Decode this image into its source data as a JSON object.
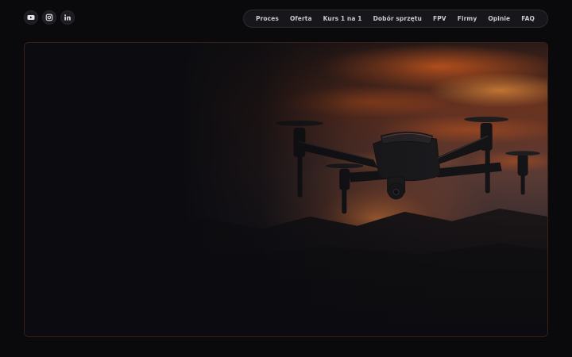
{
  "socials": [
    {
      "name": "youtube-icon"
    },
    {
      "name": "instagram-icon"
    },
    {
      "name": "linkedin-icon"
    }
  ],
  "nav": {
    "items": [
      "Proces",
      "Oferta",
      "Kurs 1 na 1",
      "Dobór sprzętu",
      "FPV",
      "Firmy",
      "Opinie",
      "FAQ"
    ]
  },
  "colors": {
    "background": "#0a0a0d",
    "sunset_orange": "#c8571e",
    "hero_border": "#3a2118"
  },
  "hero": {
    "image": "drone-at-sunset"
  }
}
